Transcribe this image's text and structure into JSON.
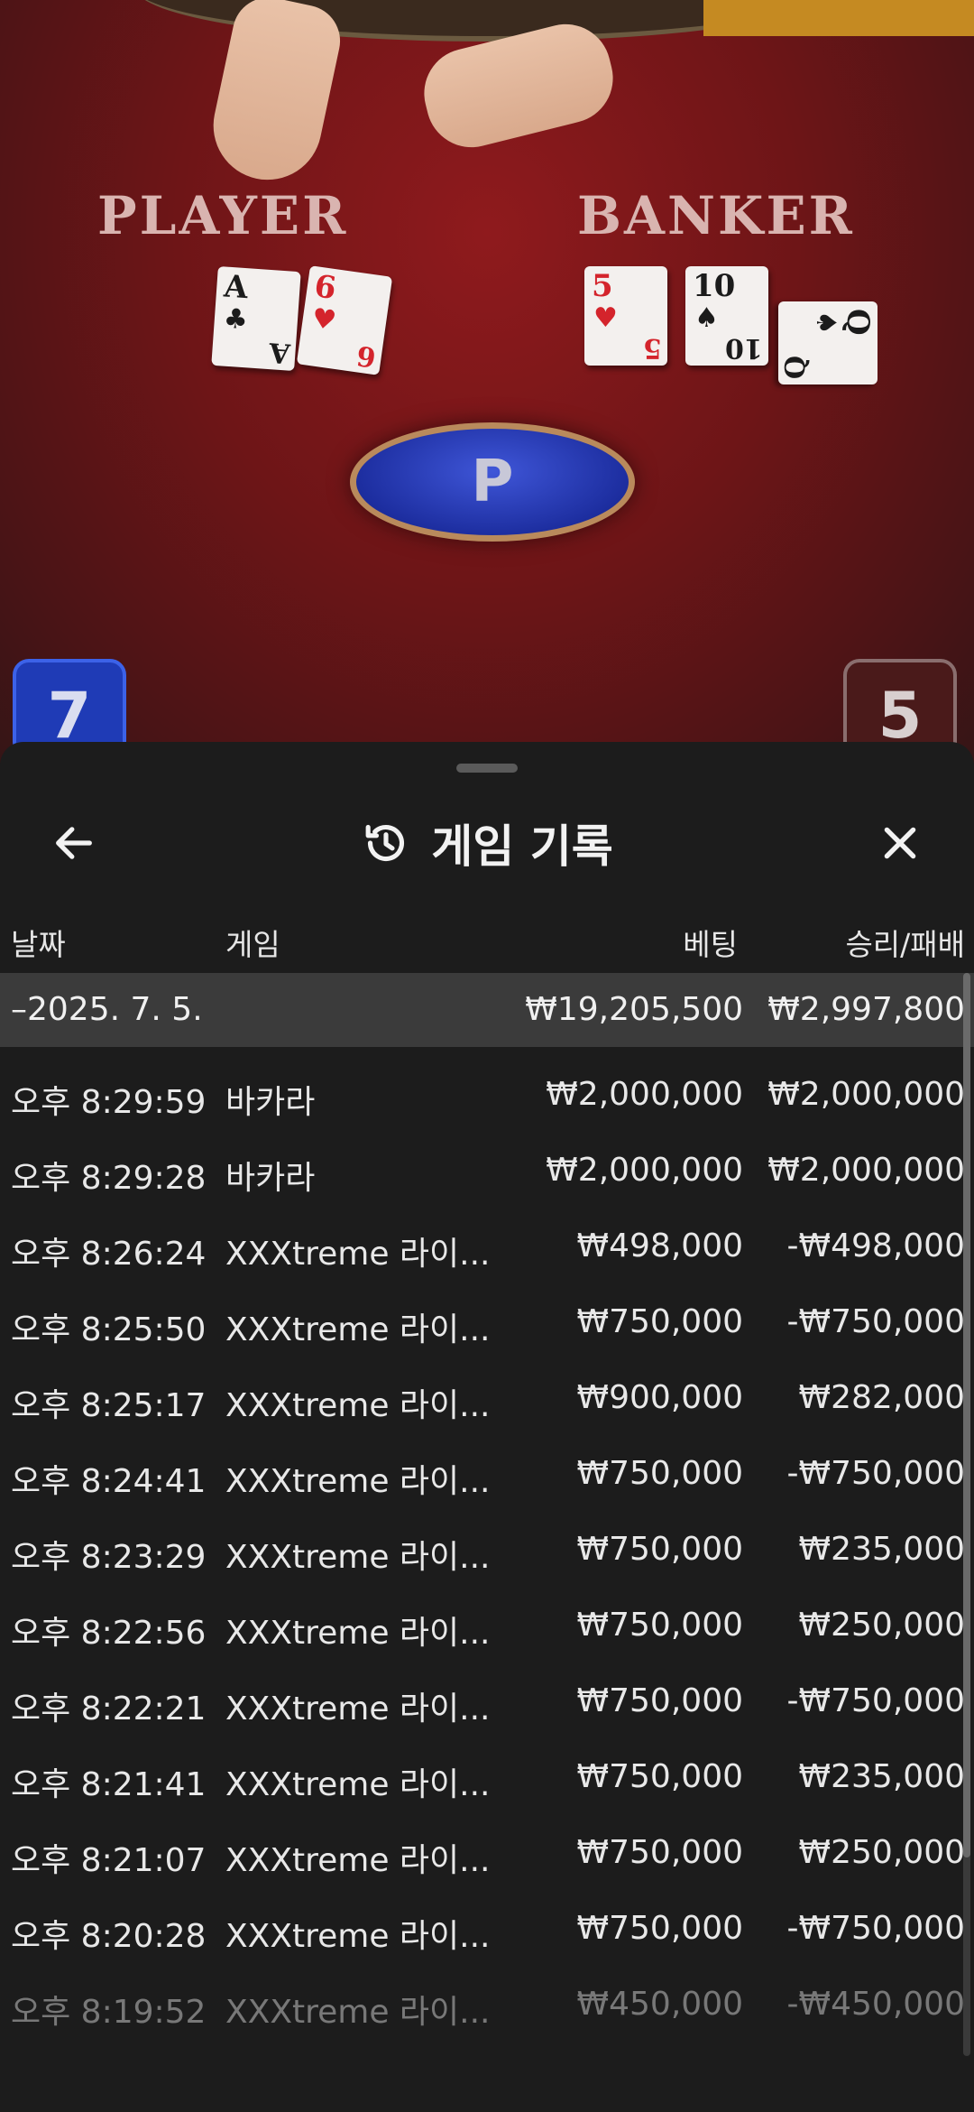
{
  "table": {
    "player_label": "PLAYER",
    "banker_label": "BANKER",
    "player_cards": [
      {
        "rank": "A",
        "suit": "♣",
        "color": "black"
      },
      {
        "rank": "6",
        "suit": "♥",
        "color": "red"
      }
    ],
    "banker_cards": [
      {
        "rank": "5",
        "suit": "♥",
        "color": "red"
      },
      {
        "rank": "10",
        "suit": "♠",
        "color": "black"
      },
      {
        "rank": "Q",
        "suit": "♠",
        "color": "black"
      }
    ],
    "result_letter": "P",
    "player_score": "7",
    "banker_score": "5"
  },
  "sheet": {
    "title": "게임 기록",
    "back_icon": "arrow-left-icon",
    "history_icon": "history-icon",
    "close_icon": "close-icon"
  },
  "columns": {
    "date": "날짜",
    "game": "게임",
    "bet": "베팅",
    "win_loss": "승리/패배"
  },
  "day_summary": {
    "date": "–2025. 7. 5.",
    "bet": "₩19,205,500",
    "win_loss": "₩2,997,800"
  },
  "rows": [
    {
      "time": "오후 8:29:59",
      "game": "바카라",
      "bet": "₩2,000,000",
      "win_loss": "₩2,000,000"
    },
    {
      "time": "오후 8:29:28",
      "game": "바카라",
      "bet": "₩2,000,000",
      "win_loss": "₩2,000,000"
    },
    {
      "time": "오후 8:26:24",
      "game": "XXXtreme 라이...",
      "bet": "₩498,000",
      "win_loss": "-₩498,000"
    },
    {
      "time": "오후 8:25:50",
      "game": "XXXtreme 라이...",
      "bet": "₩750,000",
      "win_loss": "-₩750,000"
    },
    {
      "time": "오후 8:25:17",
      "game": "XXXtreme 라이...",
      "bet": "₩900,000",
      "win_loss": "₩282,000"
    },
    {
      "time": "오후 8:24:41",
      "game": "XXXtreme 라이...",
      "bet": "₩750,000",
      "win_loss": "-₩750,000"
    },
    {
      "time": "오후 8:23:29",
      "game": "XXXtreme 라이...",
      "bet": "₩750,000",
      "win_loss": "₩235,000"
    },
    {
      "time": "오후 8:22:56",
      "game": "XXXtreme 라이...",
      "bet": "₩750,000",
      "win_loss": "₩250,000"
    },
    {
      "time": "오후 8:22:21",
      "game": "XXXtreme 라이...",
      "bet": "₩750,000",
      "win_loss": "-₩750,000"
    },
    {
      "time": "오후 8:21:41",
      "game": "XXXtreme 라이...",
      "bet": "₩750,000",
      "win_loss": "₩235,000"
    },
    {
      "time": "오후 8:21:07",
      "game": "XXXtreme 라이...",
      "bet": "₩750,000",
      "win_loss": "₩250,000"
    },
    {
      "time": "오후 8:20:28",
      "game": "XXXtreme 라이...",
      "bet": "₩750,000",
      "win_loss": "-₩750,000"
    },
    {
      "time": "오후 8:19:52",
      "game": "XXXtreme 라이...",
      "bet": "₩450,000",
      "win_loss": "-₩450,000"
    }
  ],
  "colors": {
    "sheet_bg": "#1c1c1c",
    "summary_row_bg": "#3b3b3b",
    "player_blue": "#1f3bb6",
    "table_red": "#8f1a1d"
  }
}
